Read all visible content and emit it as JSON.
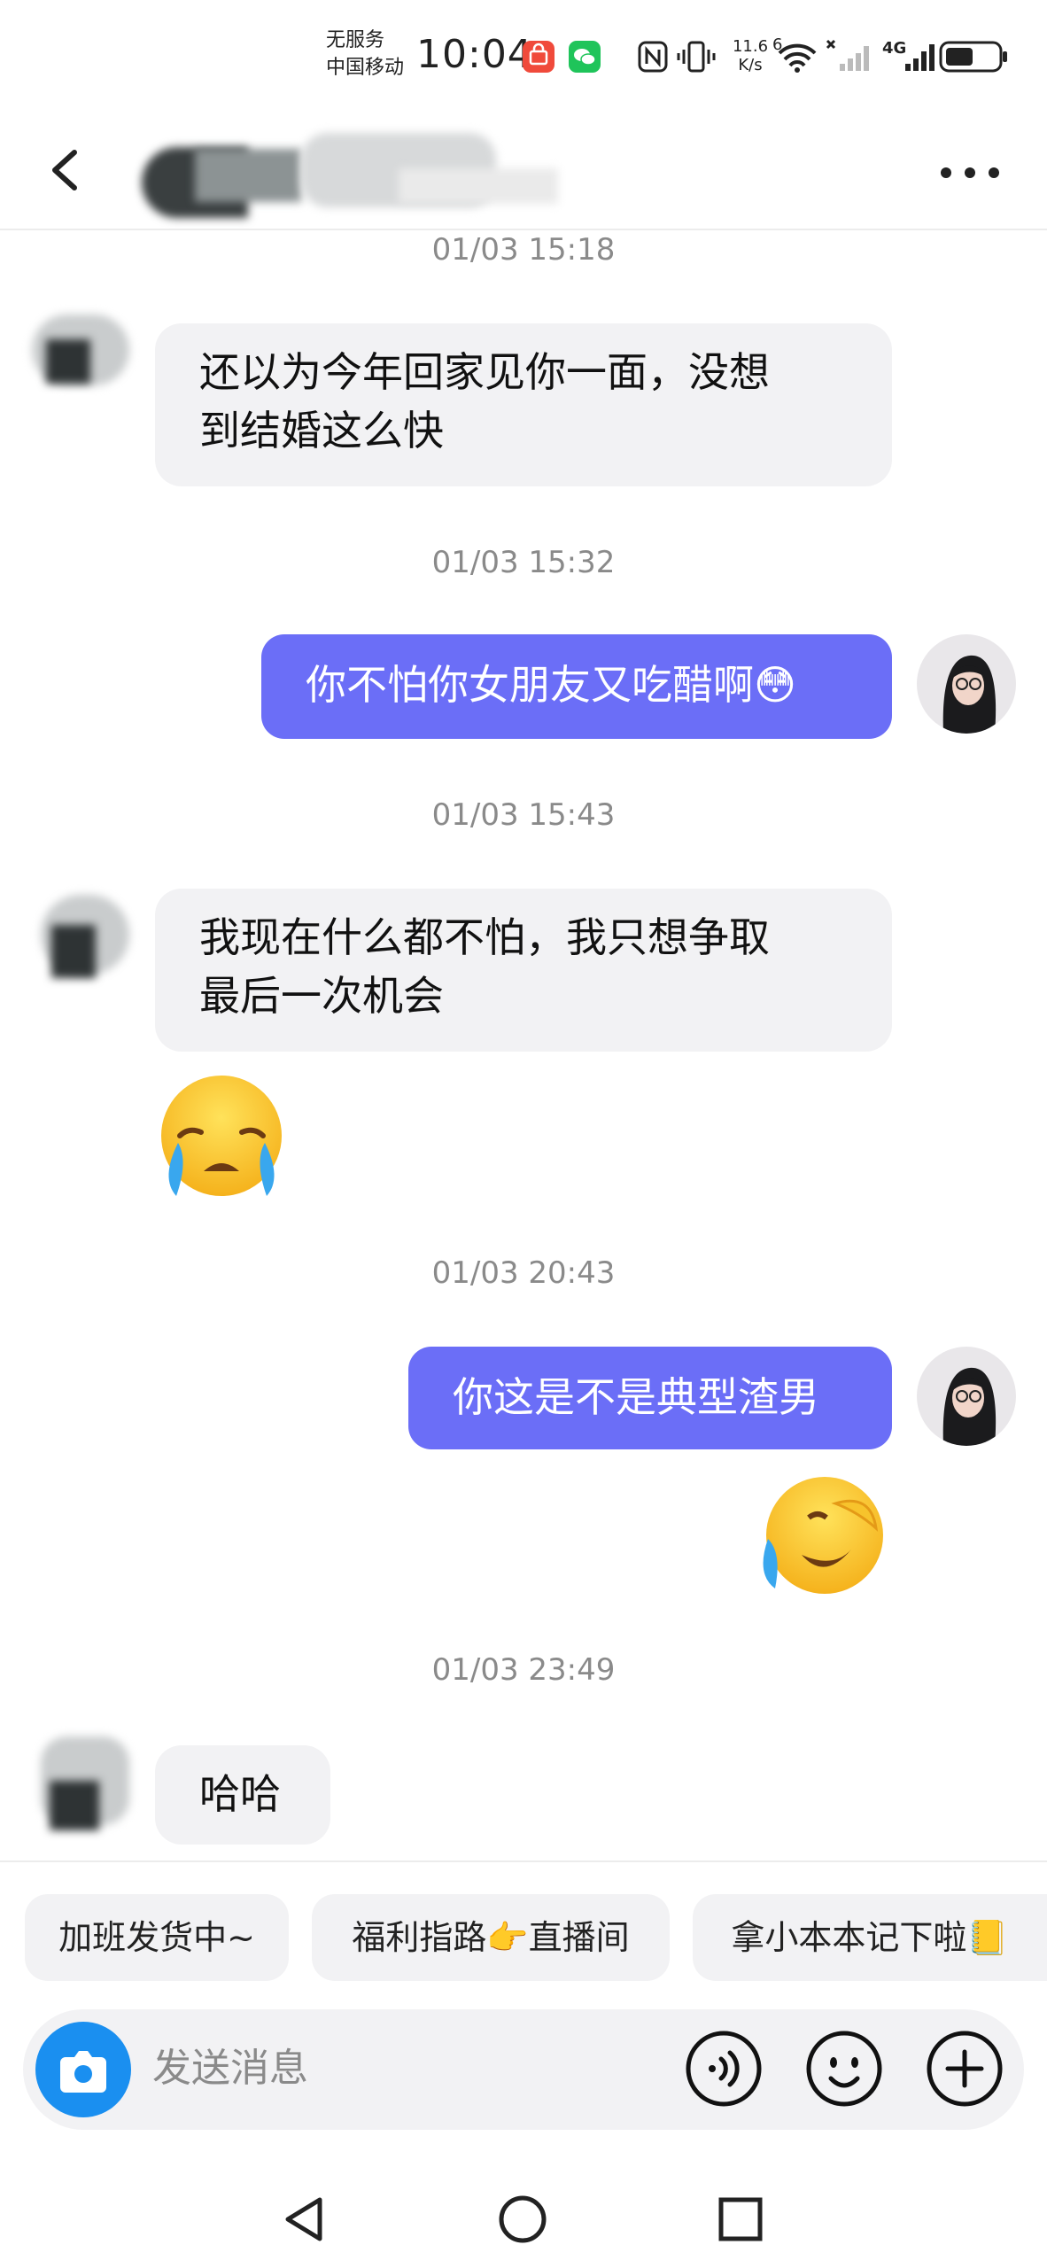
{
  "status_bar": {
    "carrier_line1": "无服务",
    "carrier_line2": "中国移动",
    "time": "10:04",
    "net_speed_value": "11.6",
    "net_speed_unit": "K/s",
    "wifi_badge": "6",
    "network_type": "4G",
    "icons": [
      "taobao-app-icon",
      "wechat-app-icon",
      "nfc-icon",
      "vibrate-icon",
      "wifi-icon",
      "signal-icon",
      "signal-icon",
      "battery-icon"
    ]
  },
  "header": {
    "title": "",
    "icons": [
      "back-icon",
      "more-icon"
    ]
  },
  "messages": [
    {
      "type": "timestamp",
      "text": "01/03 15:18"
    },
    {
      "type": "incoming",
      "text_line1": "还以为今年回家见你一面，没想",
      "text_line2": "到结婚这么快"
    },
    {
      "type": "timestamp",
      "text": "01/03 15:32"
    },
    {
      "type": "outgoing",
      "text": "你不怕你女朋友又吃醋啊😳"
    },
    {
      "type": "timestamp",
      "text": "01/03 15:43"
    },
    {
      "type": "incoming",
      "text_line1": "我现在什么都不怕，我只想争取",
      "text_line2": "最后一次机会"
    },
    {
      "type": "incoming-emoji",
      "emoji": "crying-face-emoji"
    },
    {
      "type": "timestamp",
      "text": "01/03 20:43"
    },
    {
      "type": "outgoing",
      "text": "你这是不是典型渣男"
    },
    {
      "type": "outgoing-emoji",
      "emoji": "laughing-tears-emoji"
    },
    {
      "type": "timestamp",
      "text": "01/03 23:49"
    },
    {
      "type": "incoming",
      "text": "哈哈"
    }
  ],
  "quick_replies": [
    "加班发货中~",
    "福利指路👉直播间",
    "拿小本本记下啦📒"
  ],
  "input": {
    "placeholder": "发送消息",
    "icons": [
      "camera-icon",
      "voice-icon",
      "emoji-icon",
      "plus-icon"
    ]
  },
  "nav": {
    "icons": [
      "nav-back-icon",
      "nav-home-icon",
      "nav-recents-icon"
    ]
  },
  "colors": {
    "outgoing_bubble": "#6b6ef7",
    "incoming_bubble": "#f2f2f4",
    "timestamp": "#8a8a8a",
    "camera_button": "#1a8ff0"
  }
}
